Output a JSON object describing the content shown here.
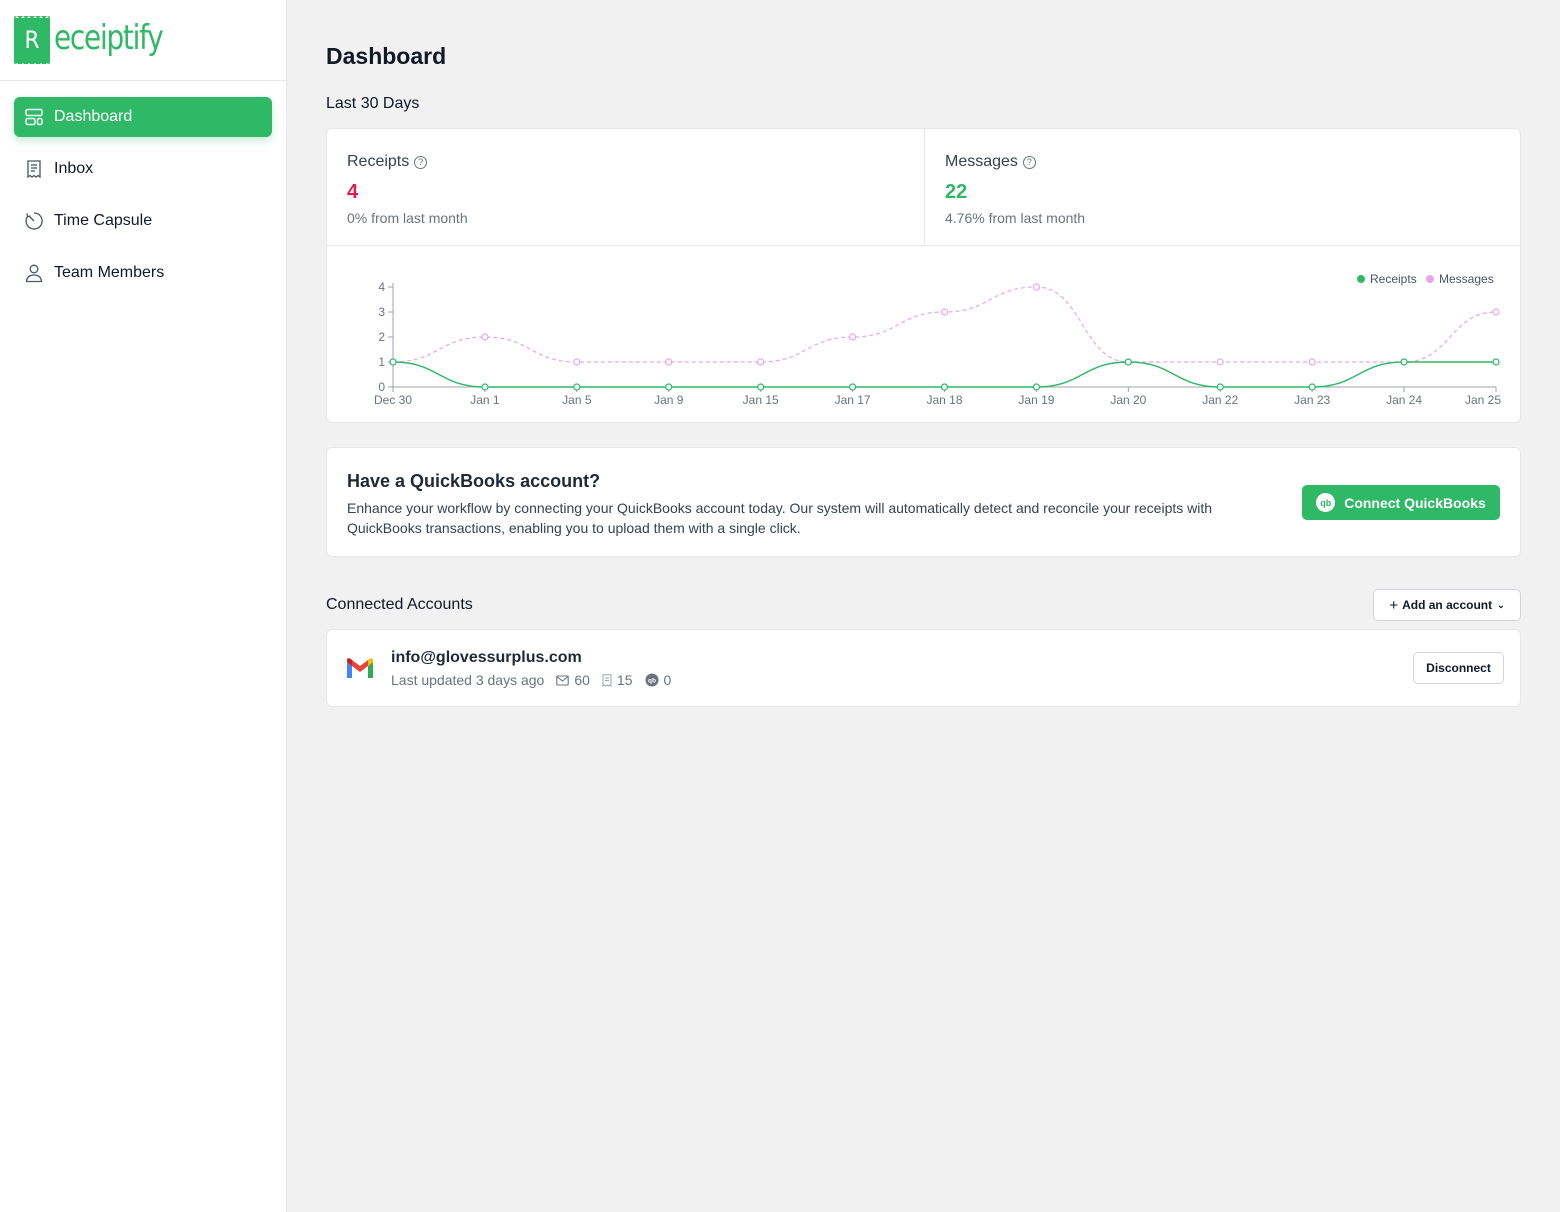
{
  "brand": {
    "letter": "R",
    "name": "eceiptify",
    "accent": "#2fb865"
  },
  "sidebar": {
    "items": [
      {
        "label": "Dashboard",
        "icon": "dashboard-icon",
        "active": true
      },
      {
        "label": "Inbox",
        "icon": "receipt-icon",
        "active": false
      },
      {
        "label": "Time Capsule",
        "icon": "timer-icon",
        "active": false
      },
      {
        "label": "Team Members",
        "icon": "user-icon",
        "active": false
      }
    ]
  },
  "page": {
    "title": "Dashboard",
    "period": "Last 30 Days"
  },
  "stats": {
    "receipts": {
      "label": "Receipts",
      "help": "?",
      "value": "4",
      "change": "0% from last month",
      "color": "#e11d48"
    },
    "messages": {
      "label": "Messages",
      "help": "?",
      "value": "22",
      "change": "4.76% from last month",
      "color": "#2fb865"
    }
  },
  "chart_data": {
    "type": "line",
    "categories": [
      "Dec 30",
      "Jan 1",
      "Jan 5",
      "Jan 9",
      "Jan 15",
      "Jan 17",
      "Jan 18",
      "Jan 19",
      "Jan 20",
      "Jan 22",
      "Jan 23",
      "Jan 24",
      "Jan 25"
    ],
    "series": [
      {
        "name": "Receipts",
        "color": "#2fb865",
        "style": "solid",
        "values": [
          1,
          0,
          0,
          0,
          0,
          0,
          0,
          0,
          1,
          0,
          0,
          1,
          1
        ]
      },
      {
        "name": "Messages",
        "color": "#e9a3f0",
        "style": "dashed",
        "values": [
          1,
          2,
          1,
          1,
          1,
          2,
          3,
          4,
          1,
          1,
          1,
          1,
          3
        ]
      }
    ],
    "yticks": [
      "0",
      "1",
      "2",
      "3",
      "4"
    ],
    "ylim": [
      0,
      4
    ],
    "legend": "top-right",
    "grid": false
  },
  "quickbooks": {
    "title": "Have a QuickBooks account?",
    "description": "Enhance your workflow by connecting your QuickBooks account today. Our system will automatically detect and reconcile your receipts with QuickBooks transactions, enabling you to upload them with a single click.",
    "button_label": "Connect QuickBooks",
    "button_icon_text": "qb"
  },
  "connected_accounts": {
    "title": "Connected Accounts",
    "add_label": "Add an account",
    "accounts": [
      {
        "email": "info@glovessurplus.com",
        "updated": "Last updated 3 days ago",
        "messages_count": "60",
        "receipts_count": "15",
        "qb_count": "0",
        "action_label": "Disconnect"
      }
    ]
  }
}
